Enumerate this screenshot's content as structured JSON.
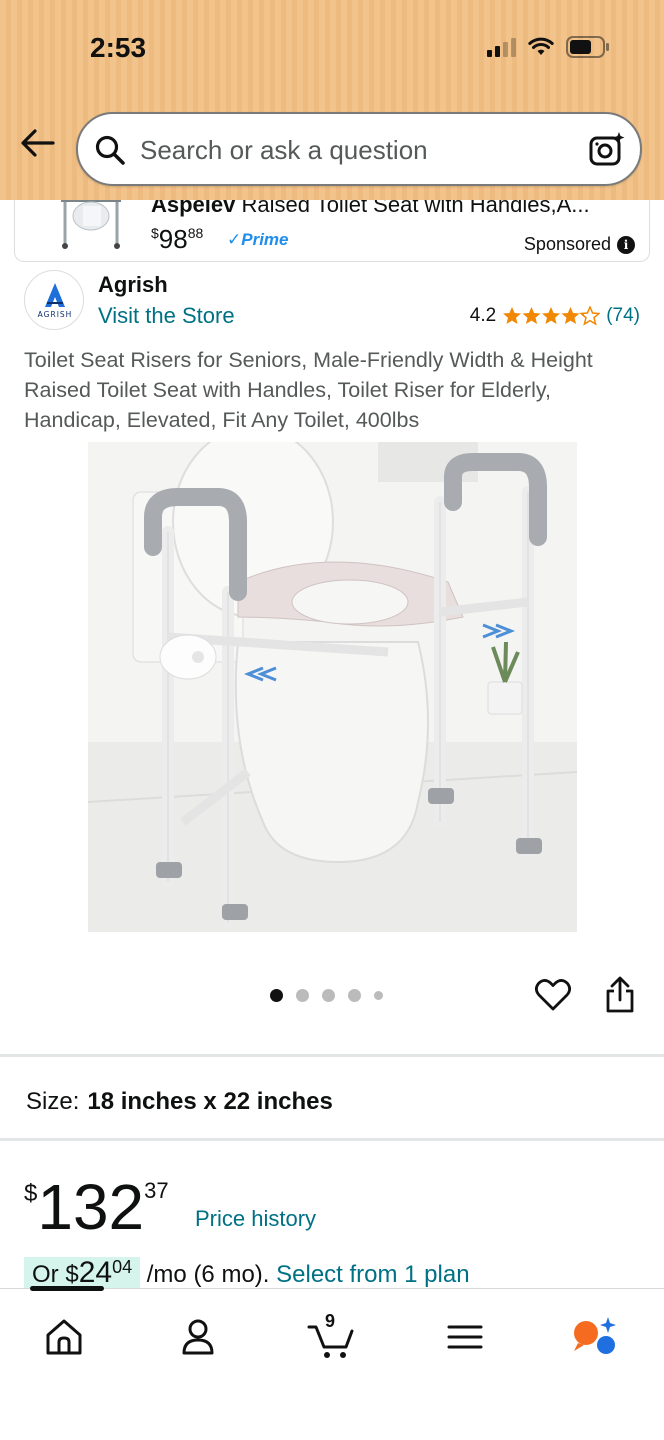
{
  "status_bar": {
    "time": "2:53"
  },
  "search": {
    "placeholder": "Search or ask a question"
  },
  "sponsored_ad": {
    "title_brand": "Aspelev",
    "title_rest": " Raised Toilet Seat with Handles,A...",
    "price_whole": "98",
    "price_fraction": "88",
    "currency": "$",
    "prime_label": "✓Prime",
    "sponsored_label": "Sponsored"
  },
  "brand": {
    "logo_text": "AGRISH",
    "name": "Agrish",
    "store_link": "Visit the Store",
    "rating": "4.2",
    "rating_value": 4.2,
    "review_count": "(74)"
  },
  "product": {
    "title": "Toilet Seat Risers for Seniors, Male-Friendly Width & Height Raised Toilet Seat with Handles, Toilet Riser for Elderly, Handicap, Elevated, Fit Any Toilet, 400lbs",
    "image_count": 5,
    "active_image": 1
  },
  "size": {
    "label": "Size:",
    "value": "18 inches x 22 inches"
  },
  "price": {
    "currency": "$",
    "whole": "132",
    "fraction": "37",
    "history_link": "Price history"
  },
  "installment": {
    "prefix": "Or $",
    "amount_whole": "24",
    "amount_fraction": "04",
    "suffix": " /mo (6 mo). ",
    "link": "Select from 1 plan"
  },
  "bottom_nav": {
    "cart_count": "9",
    "items": [
      "home",
      "account",
      "cart",
      "menu",
      "rufus"
    ]
  },
  "colors": {
    "header_bg": "#f2c48b",
    "link": "#007185",
    "star": "#f08804",
    "prime": "#1f8ded",
    "installment_bg": "#d5f5ec"
  }
}
